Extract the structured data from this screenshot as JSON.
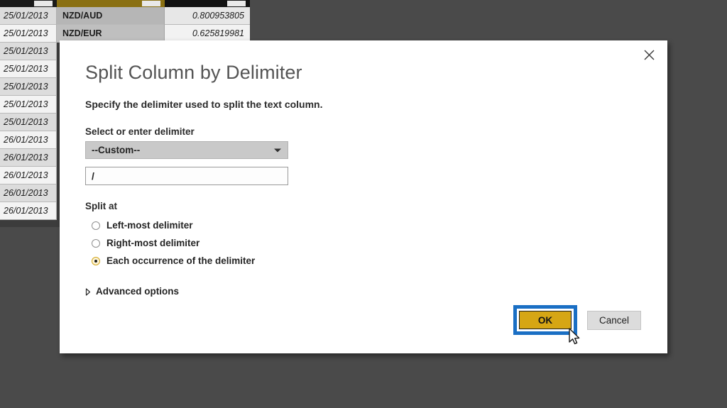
{
  "background_grid": {
    "header_columns": [
      "date-column-header",
      "currency-pair-column-header",
      "rate-column-header"
    ],
    "rows": [
      {
        "date": "25/01/2013",
        "pair": "NZD/AUD",
        "rate": "0.800953805"
      },
      {
        "date": "25/01/2013",
        "pair": "NZD/EUR",
        "rate": "0.625819981"
      },
      {
        "date": "25/01/2013",
        "pair": "",
        "rate": ""
      },
      {
        "date": "25/01/2013",
        "pair": "",
        "rate": ""
      },
      {
        "date": "25/01/2013",
        "pair": "",
        "rate": ""
      },
      {
        "date": "25/01/2013",
        "pair": "",
        "rate": ""
      },
      {
        "date": "25/01/2013",
        "pair": "",
        "rate": ""
      },
      {
        "date": "26/01/2013",
        "pair": "",
        "rate": ""
      },
      {
        "date": "26/01/2013",
        "pair": "",
        "rate": ""
      },
      {
        "date": "26/01/2013",
        "pair": "",
        "rate": ""
      },
      {
        "date": "26/01/2013",
        "pair": "",
        "rate": ""
      },
      {
        "date": "26/01/2013",
        "pair": "",
        "rate": ""
      }
    ]
  },
  "dialog": {
    "title": "Split Column by Delimiter",
    "subtitle": "Specify the delimiter used to split the text column.",
    "close_icon": "close-icon",
    "delimiter_section": {
      "label": "Select or enter delimiter",
      "selected_option": "--Custom--",
      "options": [
        "--Custom--"
      ],
      "custom_value": "/",
      "custom_placeholder": ""
    },
    "split_at": {
      "label": "Split at",
      "options": [
        {
          "label": "Left-most delimiter",
          "selected": false
        },
        {
          "label": "Right-most delimiter",
          "selected": false
        },
        {
          "label": "Each occurrence of the delimiter",
          "selected": true
        }
      ]
    },
    "advanced": {
      "label": "Advanced options",
      "expanded": false,
      "icon": "chevron-right-icon"
    },
    "buttons": {
      "ok_label": "OK",
      "cancel_label": "Cancel"
    }
  },
  "colors": {
    "accent_gold": "#d6a614",
    "highlight_blue": "#1a6fc4",
    "dialog_background": "#ffffff",
    "page_background": "#4a4a4a",
    "title_text": "#545454"
  },
  "cursor": {
    "icon": "mouse-pointer-icon"
  }
}
